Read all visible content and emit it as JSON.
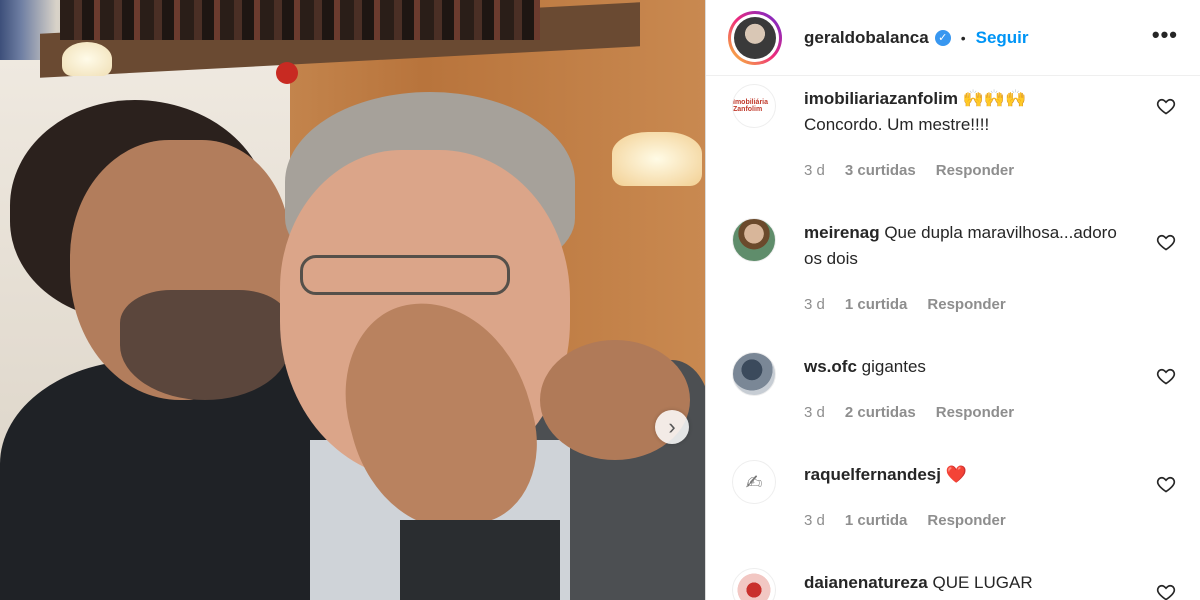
{
  "post": {
    "photo_alt": "",
    "next_icon": "chevron-right-icon"
  },
  "header": {
    "username": "geraldobalanca",
    "verified_icon": "verified-badge-icon",
    "separator": "•",
    "follow_label": "Seguir",
    "more_label": "•••"
  },
  "comments": [
    {
      "username": "imobiliariazanfolim",
      "emoji": "🙌🙌🙌",
      "text": "Concordo. Um mestre!!!!",
      "time": "3 d",
      "likes": "3 curtidas",
      "reply": "Responder",
      "avatar_text": "Imobiliária Zanfolim"
    },
    {
      "username": "meirenag",
      "text": "Que dupla maravilhosa...adoro os dois",
      "time": "3 d",
      "likes": "1 curtida",
      "reply": "Responder"
    },
    {
      "username": "ws.ofc",
      "text": "gigantes",
      "time": "3 d",
      "likes": "2 curtidas",
      "reply": "Responder"
    },
    {
      "username": "raquelfernandesj",
      "text": "❤️",
      "time": "3 d",
      "likes": "1 curtida",
      "reply": "Responder"
    },
    {
      "username": "daianenatureza",
      "text": "QUE LUGAR"
    }
  ],
  "colors": {
    "follow": "#0095f6",
    "verified": "#3897f0",
    "meta": "#8e8e8e"
  }
}
